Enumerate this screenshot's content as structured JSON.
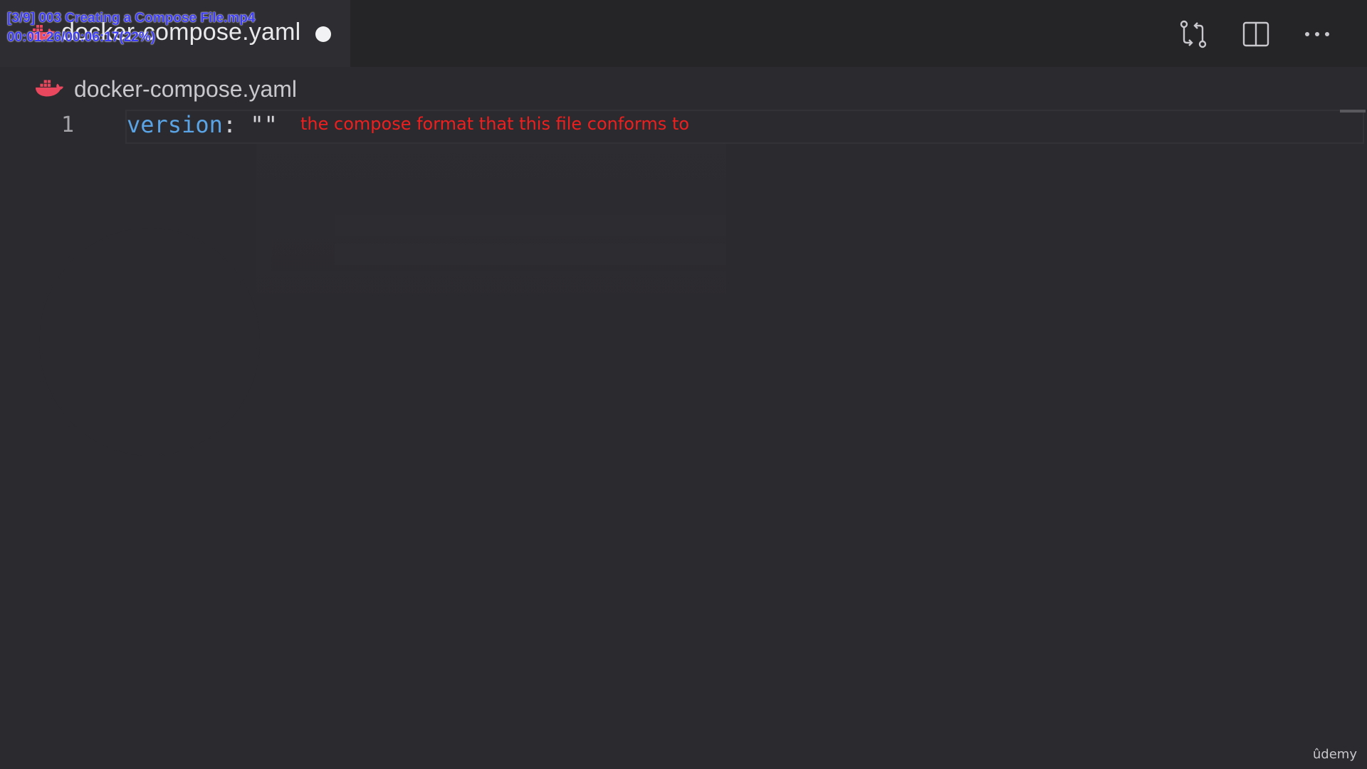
{
  "video_overlay": {
    "title_line": "[3/9] 003 Creating a Compose File.mp4",
    "time_line": "00:01:26/00:06:17(22%)",
    "progress": 0.22
  },
  "tabbar": {
    "active_tab": {
      "label": "docker-compose.yaml",
      "icon": "docker-whale-icon",
      "unsaved": true
    },
    "actions": [
      {
        "name": "open-changes-icon"
      },
      {
        "name": "split-editor-icon"
      },
      {
        "name": "more-actions-icon"
      }
    ]
  },
  "breadcrumb": {
    "icon": "docker-whale-icon",
    "label": "docker-compose.yaml"
  },
  "editor": {
    "lines": [
      {
        "number": "1",
        "key": "version",
        "colon": ":",
        "value": "\"\""
      }
    ],
    "annotation": "the compose format that this file conforms to"
  },
  "watermark": "ûdemy",
  "colors": {
    "background": "#2b2a2e",
    "yaml_key": "#5aa4e6",
    "annotation": "#ee1f1f",
    "docker_icon": "#e8475d",
    "overlay_text": "#3d3cf5"
  }
}
